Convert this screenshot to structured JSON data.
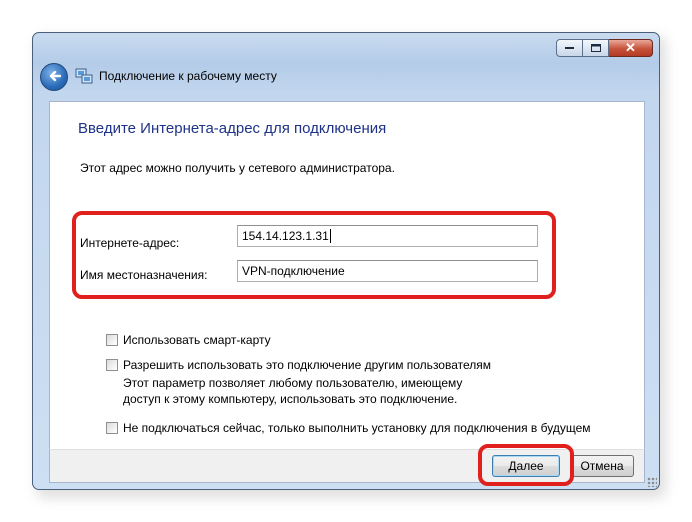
{
  "window": {
    "title": "Подключение к рабочему месту",
    "close_glyph": "✕"
  },
  "wizard": {
    "heading": "Введите Интернета-адрес для подключения",
    "hint": "Этот адрес можно получить у сетевого администратора.",
    "fields": [
      {
        "label": "Интернете-адрес:",
        "value": "154.14.123.1.31"
      },
      {
        "label": "Имя местоназначения:",
        "value": "VPN-подключение"
      }
    ],
    "options": [
      {
        "label": "Использовать смарт-карту",
        "checked": false
      },
      {
        "label": "Разрешить использовать это подключение другим пользователям",
        "checked": false,
        "description": "Этот параметр позволяет любому пользователю, имеющему доступ к этому компьютеру, использовать это подключение."
      },
      {
        "label": "Не подключаться сейчас, только выполнить установку для подключения в будущем",
        "checked": false
      }
    ]
  },
  "buttons": {
    "next": "Далее",
    "cancel": "Отмена"
  },
  "accent": {
    "highlight": "#e0201c",
    "heading": "#1e3287"
  }
}
